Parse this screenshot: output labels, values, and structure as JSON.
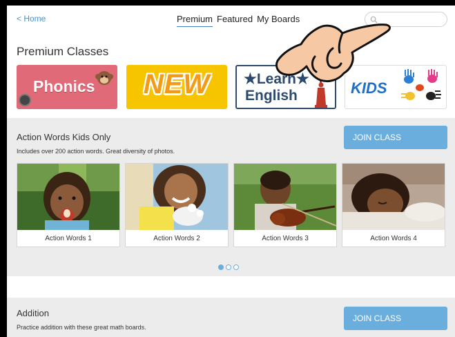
{
  "nav": {
    "home_label": "< Home",
    "tabs": [
      {
        "label": "Premium",
        "active": true
      },
      {
        "label": "Featured",
        "active": false
      },
      {
        "label": "My Boards",
        "active": false
      }
    ],
    "search_placeholder": ""
  },
  "page_title": "Premium Classes",
  "banners": {
    "phonics": "Phonics",
    "new": "NEW",
    "english_line1": "★Learn★",
    "english_line2": "English",
    "kids": "KIDS"
  },
  "sections": [
    {
      "title": "Action Words Kids Only",
      "description": "Includes over 200 action words.  Great diversity of photos.",
      "join_label": "JOIN CLASS",
      "boards": [
        {
          "label": "Action Words 1"
        },
        {
          "label": "Action Words 2"
        },
        {
          "label": "Action Words 3"
        },
        {
          "label": "Action Words 4"
        }
      ],
      "page_dots": {
        "count": 3,
        "active": 1
      }
    },
    {
      "title": "Addition",
      "description": "Practice addition with these great math boards.",
      "join_label": "JOIN CLASS"
    }
  ],
  "colors": {
    "accent": "#6aaedd",
    "link": "#4a90c8",
    "section_bg": "#ececec"
  }
}
